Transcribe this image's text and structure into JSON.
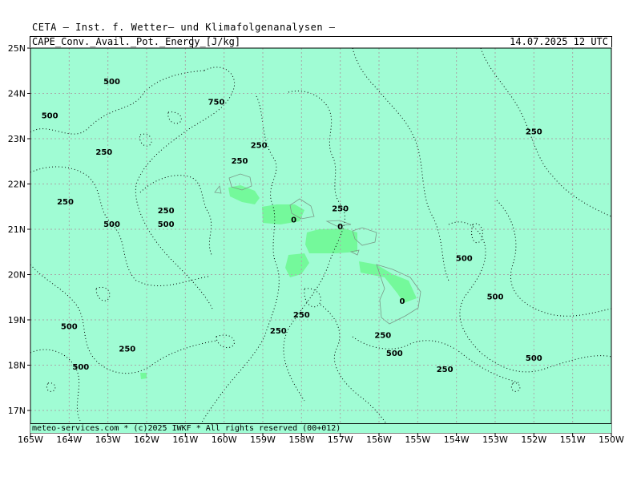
{
  "header": {
    "title": "CETA — Inst. f. Wetter— und Klimafolgenanalysen —",
    "parameter": "CAPE_Conv._Avail._Pot._Energy_[J/kg]",
    "datetime": "14.07.2025 12 UTC"
  },
  "footer": {
    "credit": "meteo-services.com * (c)2025 IWKF * All rights reserved (00+012)"
  },
  "map": {
    "region": "Hawaiian Islands",
    "background_color": "#a0fcd4",
    "positive_cape_fill_color": "#74f99b",
    "coastline_color": "#7a9a88",
    "contour_style": "dotted black",
    "grid_style": "dotted grey",
    "lon_ticks": [
      "165W",
      "164W",
      "163W",
      "162W",
      "161W",
      "160W",
      "159W",
      "158W",
      "157W",
      "156W",
      "155W",
      "154W",
      "153W",
      "152W",
      "151W",
      "150W"
    ],
    "lat_ticks": [
      "25N",
      "24N",
      "23N",
      "22N",
      "21N",
      "20N",
      "19N",
      "18N",
      "17N"
    ],
    "contour_labels": [
      {
        "text": "500",
        "lon": -162.9,
        "lat": 24.2
      },
      {
        "text": "750",
        "lon": -160.2,
        "lat": 23.75
      },
      {
        "text": "500",
        "lon": -164.5,
        "lat": 23.45
      },
      {
        "text": "250",
        "lon": -163.1,
        "lat": 22.65
      },
      {
        "text": "250",
        "lon": -159.1,
        "lat": 22.8
      },
      {
        "text": "250",
        "lon": -159.6,
        "lat": 22.45
      },
      {
        "text": "250",
        "lon": -164.1,
        "lat": 21.55
      },
      {
        "text": "250",
        "lon": -161.5,
        "lat": 21.35
      },
      {
        "text": "500",
        "lon": -162.9,
        "lat": 21.05
      },
      {
        "text": "500",
        "lon": -161.5,
        "lat": 21.05
      },
      {
        "text": "0",
        "lon": -158.2,
        "lat": 21.15
      },
      {
        "text": "250",
        "lon": -157.0,
        "lat": 21.4
      },
      {
        "text": "0",
        "lon": -157.0,
        "lat": 21.0
      },
      {
        "text": "500",
        "lon": -153.8,
        "lat": 20.3
      },
      {
        "text": "500",
        "lon": -153.0,
        "lat": 19.45
      },
      {
        "text": "0",
        "lon": -155.4,
        "lat": 19.35
      },
      {
        "text": "250",
        "lon": -158.0,
        "lat": 19.05
      },
      {
        "text": "500",
        "lon": -164.0,
        "lat": 18.8
      },
      {
        "text": "250",
        "lon": -158.6,
        "lat": 18.7
      },
      {
        "text": "250",
        "lon": -155.9,
        "lat": 18.6
      },
      {
        "text": "250",
        "lon": -162.5,
        "lat": 18.3
      },
      {
        "text": "500",
        "lon": -155.6,
        "lat": 18.2
      },
      {
        "text": "500",
        "lon": -152.0,
        "lat": 18.1
      },
      {
        "text": "500",
        "lon": -163.7,
        "lat": 17.9
      },
      {
        "text": "250",
        "lon": -154.3,
        "lat": 17.85
      },
      {
        "text": "250",
        "lon": -152.0,
        "lat": 23.1
      }
    ]
  }
}
